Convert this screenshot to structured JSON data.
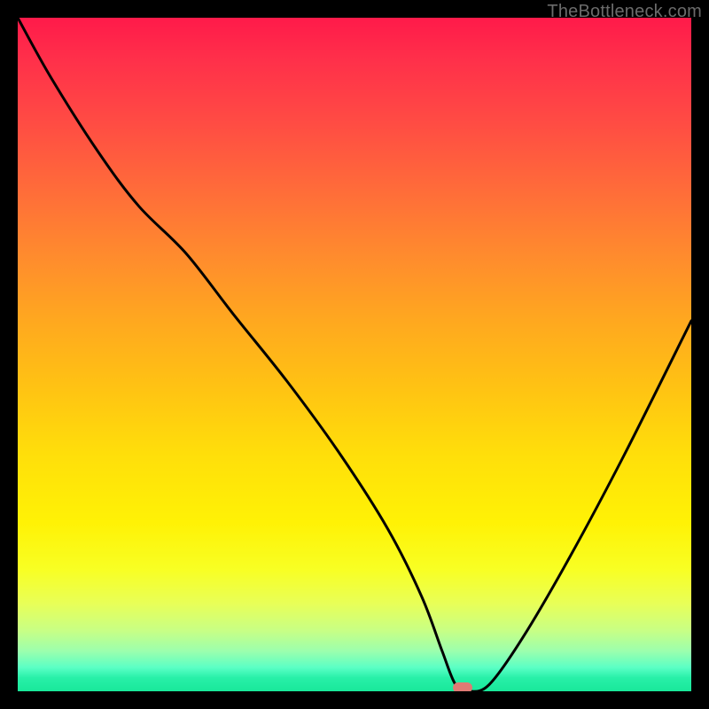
{
  "watermark": "TheBottleneck.com",
  "colors": {
    "frame": "#000000",
    "curve": "#000000",
    "marker": "#e07a74",
    "gradient_top": "#ff1a4a",
    "gradient_bottom": "#19e89a"
  },
  "chart_data": {
    "type": "line",
    "title": "",
    "xlabel": "",
    "ylabel": "",
    "xlim": [
      0,
      100
    ],
    "ylim": [
      0,
      100
    ],
    "annotations": [
      {
        "name": "optimal-marker",
        "x": 66,
        "y": 0
      }
    ],
    "series": [
      {
        "name": "bottleneck-curve",
        "x": [
          0,
          5,
          12,
          18,
          25,
          32,
          40,
          48,
          55,
          60,
          63,
          65,
          67,
          70,
          75,
          82,
          90,
          100
        ],
        "values": [
          100,
          91,
          80,
          72,
          65,
          56,
          46,
          35,
          24,
          14,
          6,
          1,
          0,
          1,
          8,
          20,
          35,
          55
        ]
      }
    ]
  }
}
